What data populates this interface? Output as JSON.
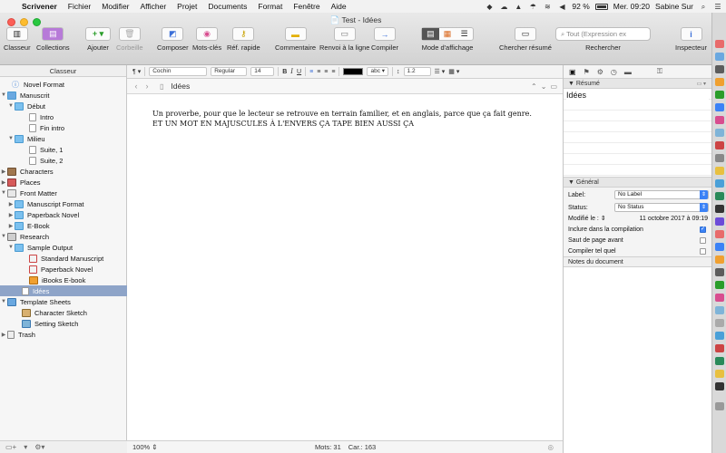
{
  "menubar": {
    "app": "Scrivener",
    "items": [
      "Fichier",
      "Modifier",
      "Afficher",
      "Projet",
      "Documents",
      "Format",
      "Fenêtre",
      "Aide"
    ],
    "battery": "92 %",
    "clock": "Mer. 09:20",
    "user": "Sabine Sur"
  },
  "window": {
    "title": "Test - Idées"
  },
  "toolbar": {
    "binder_label": "Classeur",
    "collections_label": "Collections",
    "add_label": "Ajouter",
    "trash_label": "Corbeille",
    "compose_label": "Composer",
    "keywords_label": "Mots-clés",
    "quickref_label": "Réf. rapide",
    "comment_label": "Commentaire",
    "linebreak_label": "Renvoi à la ligne",
    "compile_label": "Compiler",
    "viewmode_label": "Mode d'affichage",
    "search_synopsis_label": "Chercher résumé",
    "search_placeholder": "Tout (Expression ex",
    "search_label": "Rechercher",
    "inspector_label": "Inspecteur"
  },
  "binder": {
    "header": "Classeur",
    "items": [
      {
        "label": "Novel Format",
        "icon": "novel-icon"
      },
      {
        "label": "Manuscrit",
        "icon": "folder-icon"
      },
      {
        "label": "Début",
        "icon": "folder-icon"
      },
      {
        "label": "Intro",
        "icon": "doc-icon"
      },
      {
        "label": "Fin intro",
        "icon": "doc-icon"
      },
      {
        "label": "Milieu",
        "icon": "folder-icon"
      },
      {
        "label": "Suite, 1",
        "icon": "doc-icon"
      },
      {
        "label": "Suite, 2",
        "icon": "doc-icon"
      },
      {
        "label": "Characters",
        "icon": "characters-icon"
      },
      {
        "label": "Places",
        "icon": "places-icon"
      },
      {
        "label": "Front Matter",
        "icon": "frontmatter-icon"
      },
      {
        "label": "Manuscript Format",
        "icon": "folder-icon"
      },
      {
        "label": "Paperback Novel",
        "icon": "folder-icon"
      },
      {
        "label": "E-Book",
        "icon": "folder-icon"
      },
      {
        "label": "Research",
        "icon": "research-icon"
      },
      {
        "label": "Sample Output",
        "icon": "folder-icon"
      },
      {
        "label": "Standard Manuscript",
        "icon": "pdf-icon"
      },
      {
        "label": "Paperback Novel",
        "icon": "pdf-icon"
      },
      {
        "label": "iBooks E-book",
        "icon": "ibooks-icon"
      },
      {
        "label": "Idées",
        "icon": "doc-icon"
      },
      {
        "label": "Template Sheets",
        "icon": "template-icon"
      },
      {
        "label": "Character Sketch",
        "icon": "sketch-icon"
      },
      {
        "label": "Setting Sketch",
        "icon": "sketch-icon"
      },
      {
        "label": "Trash",
        "icon": "trash-icon"
      }
    ]
  },
  "formatbar": {
    "font": "Cochin",
    "style": "Regular",
    "size": "14",
    "line_spacing": "1.2",
    "text_color": "#000000"
  },
  "editor": {
    "title": "Idées",
    "line1": "Un proverbe, pour que le lecteur se retrouve en terrain familier, et en anglais, parce que ça fait genre.",
    "line2": "ET UN MOT EN MAJUSCULES À L'ENVERS ÇA TAPE BIEN AUSSI ÇA",
    "zoom": "100%",
    "words": "Mots: 31",
    "chars": "Car.: 163"
  },
  "inspector": {
    "synopsis_header": "Résumé",
    "synopsis_title": "Idées",
    "general_header": "Général",
    "label_label": "Label:",
    "label_value": "No Label",
    "status_label": "Status:",
    "status_value": "No Status",
    "modified_label": "Modifié le :",
    "modified_value": "11 octobre 2017 à 09:19",
    "include_compile": "Inclure dans la compilation",
    "page_break": "Saut de page avant",
    "compile_as_is": "Compiler tel quel",
    "notes_header": "Notes du document",
    "include_checked": true
  },
  "colors": {
    "selection": "#8ea4c8",
    "accent": "#3b82f6"
  }
}
